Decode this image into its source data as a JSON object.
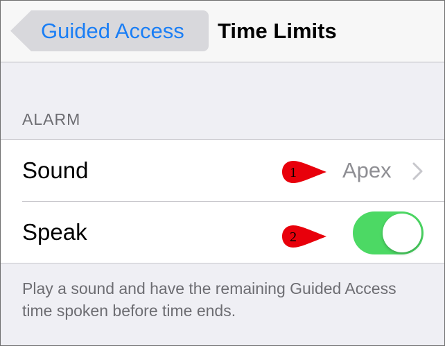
{
  "navbar": {
    "back_label": "Guided Access",
    "title": "Time Limits"
  },
  "alarm_section": {
    "header": "ALARM",
    "rows": [
      {
        "label": "Sound",
        "value": "Apex",
        "marker": "1"
      },
      {
        "label": "Speak",
        "toggle_on": true,
        "marker": "2"
      }
    ],
    "footer": "Play a sound and have the remaining Guided Access time spoken before time ends."
  },
  "colors": {
    "accent": "#1a7ef5",
    "toggle_on": "#4cd964",
    "marker": "#e8000b"
  },
  "icons": [
    "chevron-right-icon",
    "callout-marker-icon"
  ]
}
